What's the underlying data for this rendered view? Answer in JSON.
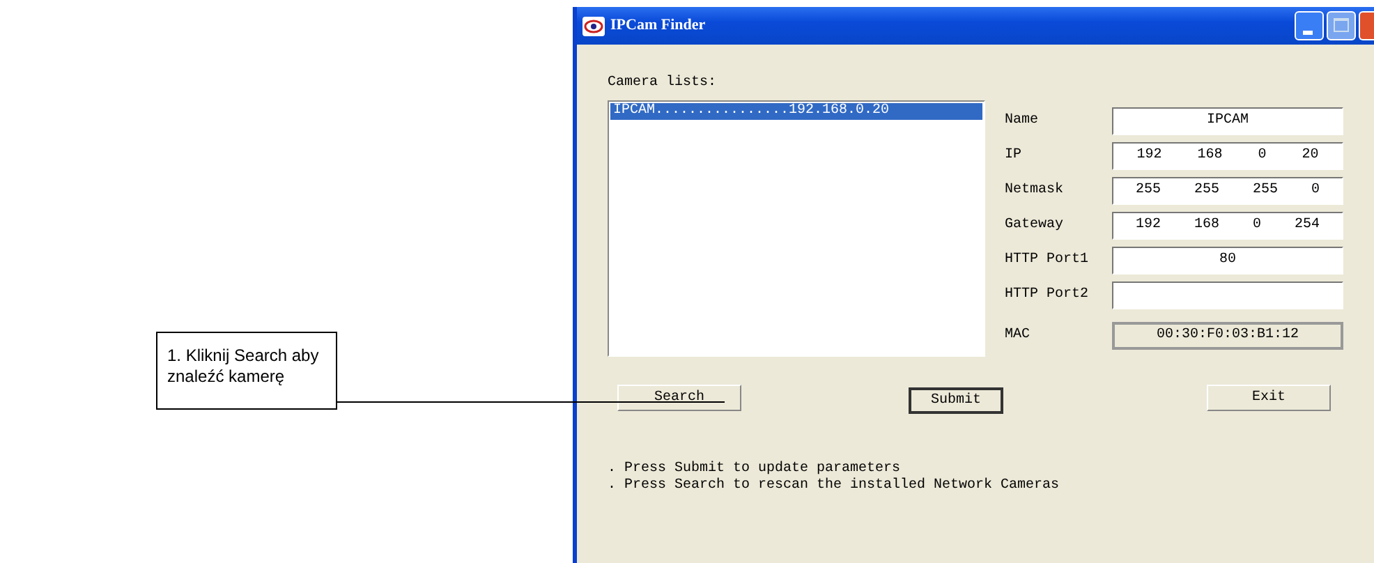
{
  "window": {
    "title": "IPCam Finder"
  },
  "camera_list": {
    "label": "Camera lists:",
    "items": [
      {
        "text": "IPCAM................192.168.0.20",
        "selected": true
      }
    ]
  },
  "fields": [
    {
      "label": "Name",
      "kind": "text",
      "value": "IPCAM",
      "disabled": false
    },
    {
      "label": "IP",
      "kind": "octets",
      "octets": [
        "192",
        "168",
        "0",
        "20"
      ]
    },
    {
      "label": "Netmask",
      "kind": "octets",
      "octets": [
        "255",
        "255",
        "255",
        "0"
      ]
    },
    {
      "label": "Gateway",
      "kind": "octets",
      "octets": [
        "192",
        "168",
        "0",
        "254"
      ]
    },
    {
      "label": "HTTP Port1",
      "kind": "text",
      "value": "80",
      "disabled": false
    },
    {
      "label": "HTTP Port2",
      "kind": "text",
      "disabled": false
    },
    {
      "label": "MAC",
      "kind": "text",
      "value": "00:30:F0:03:B1:12",
      "disabled": true
    }
  ],
  "buttons": [
    {
      "label": "Search",
      "default": false
    },
    {
      "label": "Submit",
      "default": true
    },
    {
      "label": "Exit",
      "default": false
    }
  ],
  "notes": [
    ". Press Submit to update parameters",
    ". Press Search to rescan the installed Network Cameras"
  ],
  "callout": {
    "text": "1. Kliknij Search aby znaleźć kamerę"
  }
}
